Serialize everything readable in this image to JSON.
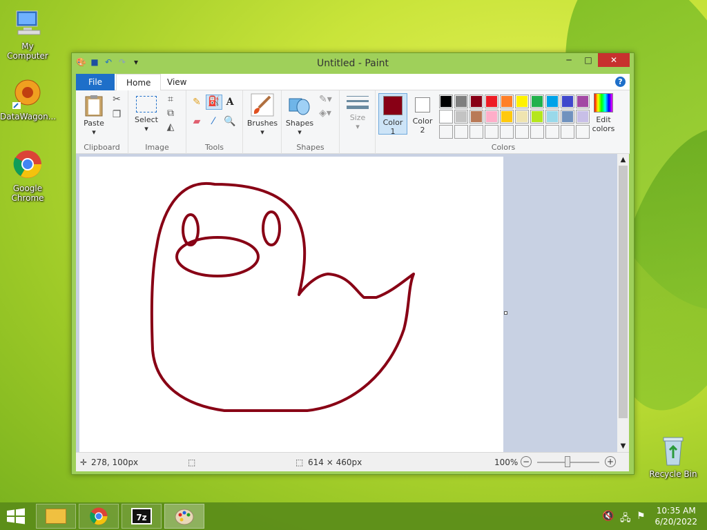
{
  "desktop": {
    "icons": [
      {
        "label": "My Computer"
      },
      {
        "label": "DataWagon..."
      },
      {
        "label": "Google Chrome"
      },
      {
        "label": "Recycle Bin"
      }
    ]
  },
  "window": {
    "title": "Untitled - Paint",
    "tabs": {
      "file": "File",
      "home": "Home",
      "view": "View"
    },
    "help": "?",
    "ribbon": {
      "clipboard": {
        "label": "Clipboard",
        "paste": "Paste"
      },
      "image": {
        "label": "Image",
        "select": "Select"
      },
      "tools": {
        "label": "Tools"
      },
      "brushes": "Brushes",
      "shapes": {
        "label": "Shapes",
        "button": "Shapes"
      },
      "size": "Size",
      "colors": {
        "label": "Colors",
        "color1_line1": "Color",
        "color1_line2": "1",
        "color2_line1": "Color",
        "color2_line2": "2",
        "edit_line1": "Edit",
        "edit_line2": "colors",
        "color1": "#880015",
        "color2": "#ffffff",
        "row1": [
          "#000000",
          "#7f7f7f",
          "#880015",
          "#ed1c24",
          "#ff7f27",
          "#fff200",
          "#22b14c",
          "#00a2e8",
          "#3f48cc",
          "#a349a4"
        ],
        "row2": [
          "#ffffff",
          "#c3c3c3",
          "#b97a57",
          "#ffaec9",
          "#ffc90e",
          "#efe4b0",
          "#b5e61d",
          "#99d9ea",
          "#7092be",
          "#c8bfe7"
        ]
      }
    },
    "drawing": {
      "stroke_color": "#880015"
    },
    "status": {
      "cursor_pos": "278, 100px",
      "canvas_size": "614 × 460px",
      "zoom": "100%"
    }
  },
  "taskbar": {
    "time": "10:35 AM",
    "date": "6/20/2022"
  }
}
